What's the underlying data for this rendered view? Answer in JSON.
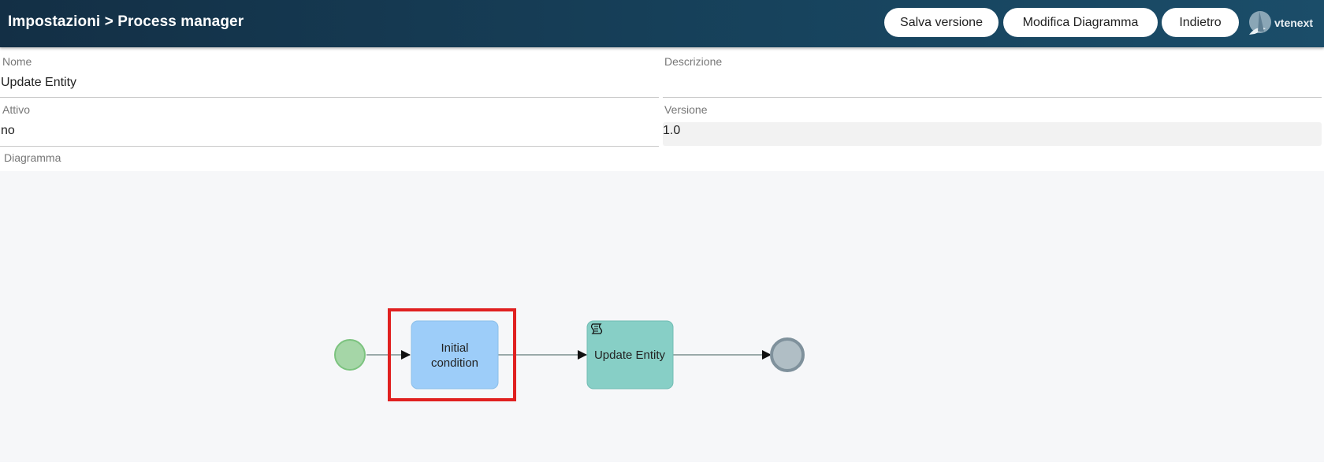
{
  "header": {
    "title": "Impostazioni > Process manager",
    "buttons": {
      "save_version": "Salva versione",
      "edit_diagram": "Modifica Diagramma",
      "back": "Indietro"
    },
    "logo_text": "vtenext"
  },
  "form": {
    "name": {
      "label": "Nome",
      "value": "Update Entity"
    },
    "description": {
      "label": "Descrizione",
      "value": ""
    },
    "active": {
      "label": "Attivo",
      "value": "no"
    },
    "version": {
      "label": "Versione",
      "value": "1.0"
    },
    "diagram": {
      "label": "Diagramma"
    }
  },
  "diagram": {
    "start_event_color": "#a5d6a7",
    "end_event_color": "#b0bec5",
    "initial_task": {
      "line1": "Initial",
      "line2": "condition",
      "color": "#9dcdf9"
    },
    "script_task": {
      "label": "Update Entity",
      "color": "#87cfc6",
      "icon": "script-icon"
    },
    "highlight_color": "#e02020"
  }
}
